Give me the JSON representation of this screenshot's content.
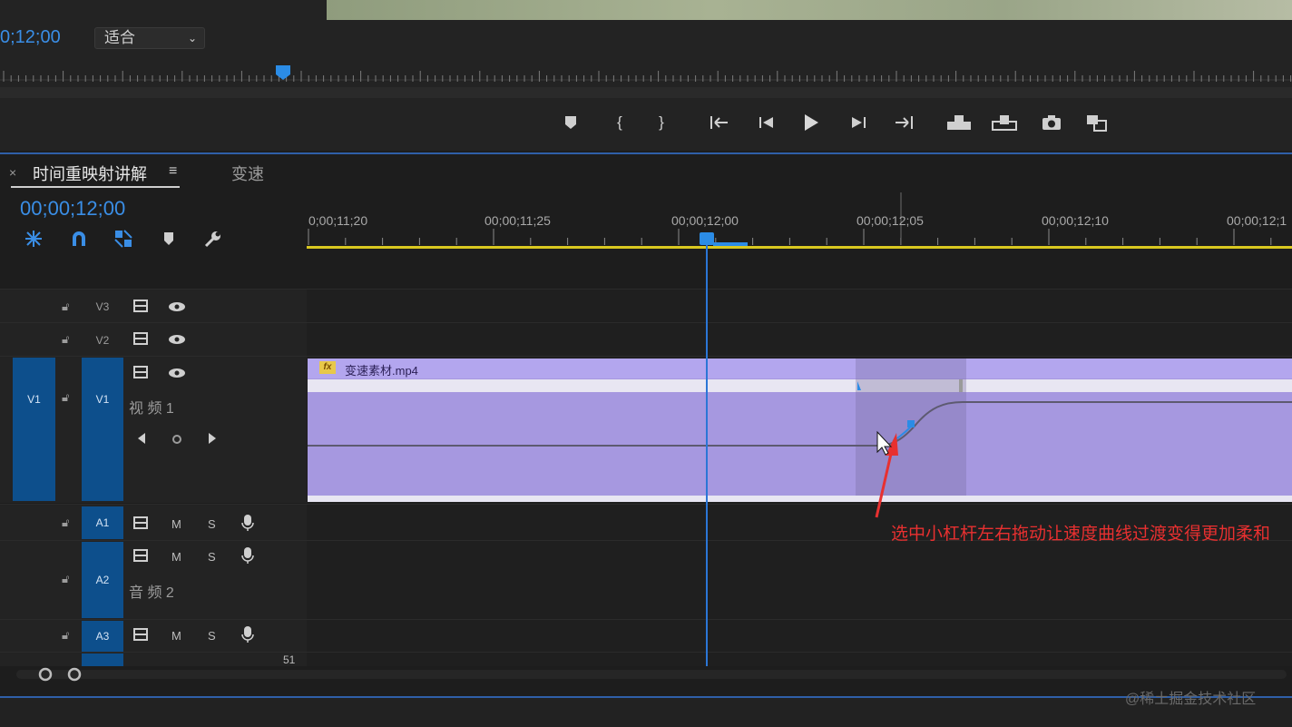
{
  "monitor": {
    "timecode": "0;12;00",
    "fit_value": "适合"
  },
  "transport": {
    "buttons": [
      "marker",
      "mark-in",
      "mark-out",
      "go-to-in",
      "step-back",
      "play",
      "step-forward",
      "go-to-out",
      "insert",
      "overwrite",
      "export-frame",
      "compare"
    ]
  },
  "timeline": {
    "tab_close": "×",
    "tab_active": "时间重映射讲解",
    "tab_menu": "≡",
    "tab_other": "变速",
    "timecode": "00;00;12;00",
    "ruler_labels": [
      "0;00;11;20",
      "00;00;11;25",
      "00;00;12;00",
      "00;00;12;05",
      "00;00;12;10",
      "00;00;12;1"
    ]
  },
  "tracks": {
    "v3": {
      "name": "V3"
    },
    "v2": {
      "name": "V2"
    },
    "v1": {
      "source": "V1",
      "name": "V1",
      "label": "视 频 1"
    },
    "a1": {
      "name": "A1",
      "m": "M",
      "s": "S"
    },
    "a2": {
      "name": "A2",
      "m": "M",
      "s": "S",
      "label": "音 频 2"
    },
    "a3": {
      "name": "A3",
      "m": "M",
      "s": "S"
    },
    "a4_partial": "51"
  },
  "clip": {
    "fx_badge": "fx",
    "name": "变速素材.mp4"
  },
  "annotation": "选中小杠杆左右拖动让速度曲线过渡变得更加柔和",
  "watermark": "@稀土掘金技术社区",
  "colors": {
    "accent_blue": "#3a8ee6",
    "clip_purple": "#a698e0",
    "annotation_red": "#e83030",
    "work_area_yellow": "#d9c820"
  }
}
